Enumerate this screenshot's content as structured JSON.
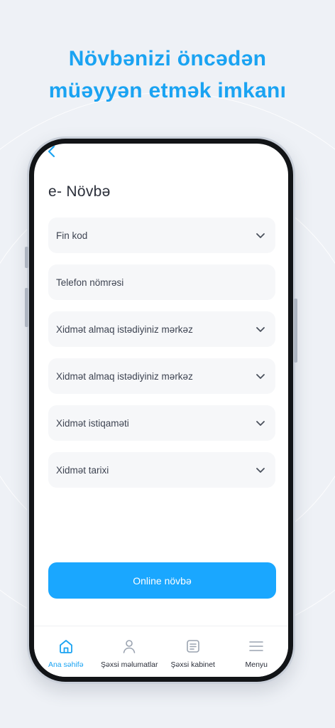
{
  "headline": {
    "line1": "Növbənizi öncədən",
    "line2": "müəyyən etmək imkanı"
  },
  "screen": {
    "title": "e- Növbə",
    "fields": [
      {
        "label": "Fin kod",
        "has_dropdown": true
      },
      {
        "label": "Telefon nömrəsi",
        "has_dropdown": false
      },
      {
        "label": "Xidmət almaq istədiyiniz mərkəz",
        "has_dropdown": true
      },
      {
        "label": "Xidmət almaq istədiyiniz mərkəz",
        "has_dropdown": true
      },
      {
        "label": "Xidmət istiqaməti",
        "has_dropdown": true
      },
      {
        "label": "Xidmət tarixi",
        "has_dropdown": true
      }
    ],
    "submit_label": "Online növbə"
  },
  "tabbar": {
    "items": [
      {
        "label": "Ana səhifə",
        "icon": "home-icon",
        "active": true
      },
      {
        "label": "Şəxsi məlumatlar",
        "icon": "user-icon",
        "active": false
      },
      {
        "label": "Şəxsi kabinet",
        "icon": "document-icon",
        "active": false
      },
      {
        "label": "Menyu",
        "icon": "menu-icon",
        "active": false
      }
    ]
  },
  "colors": {
    "accent": "#1aa3f2",
    "button": "#1aa7ff",
    "background": "#eef1f6",
    "field_bg": "#f6f7f9"
  }
}
